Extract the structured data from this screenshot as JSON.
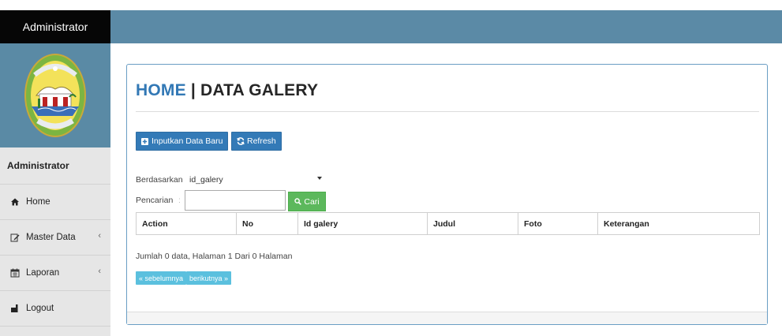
{
  "brand": "Administrator",
  "sidebar": {
    "header": "Administrator",
    "items": [
      {
        "label": "Home",
        "icon": "home-icon"
      },
      {
        "label": "Master Data",
        "icon": "edit-icon",
        "chevron": "‹"
      },
      {
        "label": "Laporan",
        "icon": "calendar-icon",
        "chevron": "‹"
      },
      {
        "label": "Logout",
        "icon": "logout-icon"
      }
    ]
  },
  "page": {
    "title_home": "HOME",
    "title_sep": " | ",
    "title_main": "DATA GALERY"
  },
  "toolbar": {
    "add_label": "Inputkan Data Baru",
    "refresh_label": "Refresh"
  },
  "filter": {
    "by_label": "Berdasarkan:",
    "by_value": "id_galery",
    "search_label": "Pencarian",
    "search_sep": ":",
    "search_value": "",
    "search_button": "Cari"
  },
  "table": {
    "columns": [
      "Action",
      "No",
      "Id galery",
      "Judul",
      "Foto",
      "Keterangan"
    ],
    "rows": []
  },
  "pagination": {
    "info": "Jumlah 0 data, Halaman 1 Dari 0 Halaman",
    "prev": "« sebelumnya",
    "next": "berikutnya »"
  },
  "colors": {
    "topbar": "#5b8aa6",
    "primary": "#337ab7",
    "success": "#5cb85c",
    "info": "#5bc0de"
  }
}
